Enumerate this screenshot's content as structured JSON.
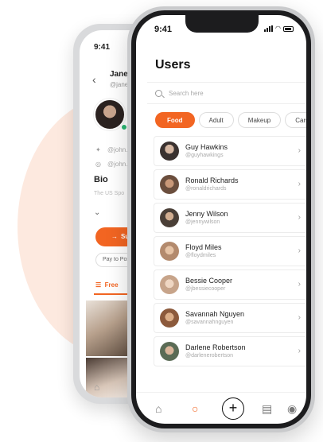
{
  "colors": {
    "accent": "#f26522",
    "online": "#2bb673",
    "blob": "#fde9df"
  },
  "back_phone": {
    "time": "9:41",
    "profile_name": "Jane C",
    "profile_handle": "@janec",
    "twitter_handle": "@john.do",
    "instagram_handle": "@john.do",
    "bio_label": "Bio",
    "bio_text": "The US Spo",
    "subscribe_label": "Subs",
    "pay_label": "Pay to Pos",
    "free_tab_label": "Free",
    "icons": [
      "back-arrow-icon",
      "twitter-icon",
      "instagram-icon",
      "chevron-down-icon",
      "subscribe-icon",
      "menu-icon",
      "home-icon"
    ]
  },
  "front_phone": {
    "time": "9:41",
    "title": "Users",
    "search": {
      "placeholder": "Search here"
    },
    "chips": [
      {
        "label": "Food",
        "active": true
      },
      {
        "label": "Adult",
        "active": false
      },
      {
        "label": "Makeup",
        "active": false
      },
      {
        "label": "Cars",
        "active": false
      },
      {
        "label": "Ca",
        "active": false
      }
    ],
    "users": [
      {
        "name": "Guy Hawkins",
        "handle": "@guyhawkings",
        "avatar_color": "#3a3230"
      },
      {
        "name": "Ronald Richards",
        "handle": "@ronaldrichards",
        "avatar_color": "#6b4e3d"
      },
      {
        "name": "Jenny Wilson",
        "handle": "@jennywilson",
        "avatar_color": "#4a3f37"
      },
      {
        "name": "Floyd Miles",
        "handle": "@floydmiles",
        "avatar_color": "#b38a6d"
      },
      {
        "name": "Bessie Cooper",
        "handle": "@jbessiecooper",
        "avatar_color": "#c7a48a"
      },
      {
        "name": "Savannah Nguyen",
        "handle": "@savannahnguyen",
        "avatar_color": "#8c5a3c"
      },
      {
        "name": "Darlene Robertson",
        "handle": "@darlenerobertson",
        "avatar_color": "#5a6b55"
      }
    ],
    "tabbar": [
      "home-icon",
      "search-icon",
      "add-icon",
      "messages-icon",
      "profile-icon"
    ]
  }
}
